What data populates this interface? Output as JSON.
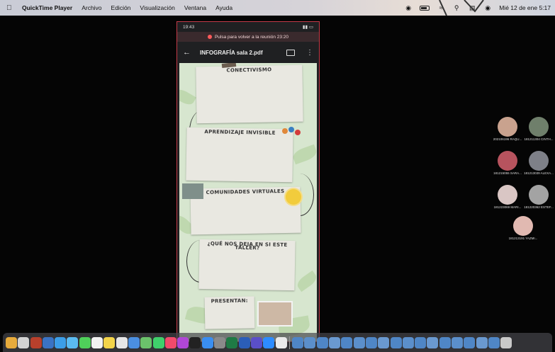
{
  "menubar": {
    "app_name": "QuickTime Player",
    "menus": [
      "Archivo",
      "Edición",
      "Visualización",
      "Ventana",
      "Ayuda"
    ],
    "datetime": "Mié 12 de ene  5:17"
  },
  "phone": {
    "status_time": "19:43",
    "return_banner": "Pulsa para volver a la reunión 23:20",
    "doc_title": "INFOGRAFÍA sala 2.pdf",
    "sections": [
      {
        "title": "CONECTIVISMO"
      },
      {
        "title": "APRENDIZAJE INVISIBLE"
      },
      {
        "title": "COMUNIDADES VIRTUALES"
      },
      {
        "title": "¿QUÉ NOS DEJA EN SI ESTE TALLER?"
      },
      {
        "title": "PRESENTAN:"
      }
    ]
  },
  "participants": [
    {
      "name": "202106196 RAQU..."
    },
    {
      "name": "181211304 CINTH..."
    },
    {
      "name": "181215055 SARA..."
    },
    {
      "name": "181213039 ALEXA..."
    },
    {
      "name": "181223069 MARI..."
    },
    {
      "name": "181220362 ESTEF..."
    },
    {
      "name": "181213191 YAZMI..."
    }
  ],
  "colors": {
    "phone_border": "#c33a47",
    "doc_background": "#d7e6cf",
    "return_banner_bg": "#3a2a2d"
  }
}
